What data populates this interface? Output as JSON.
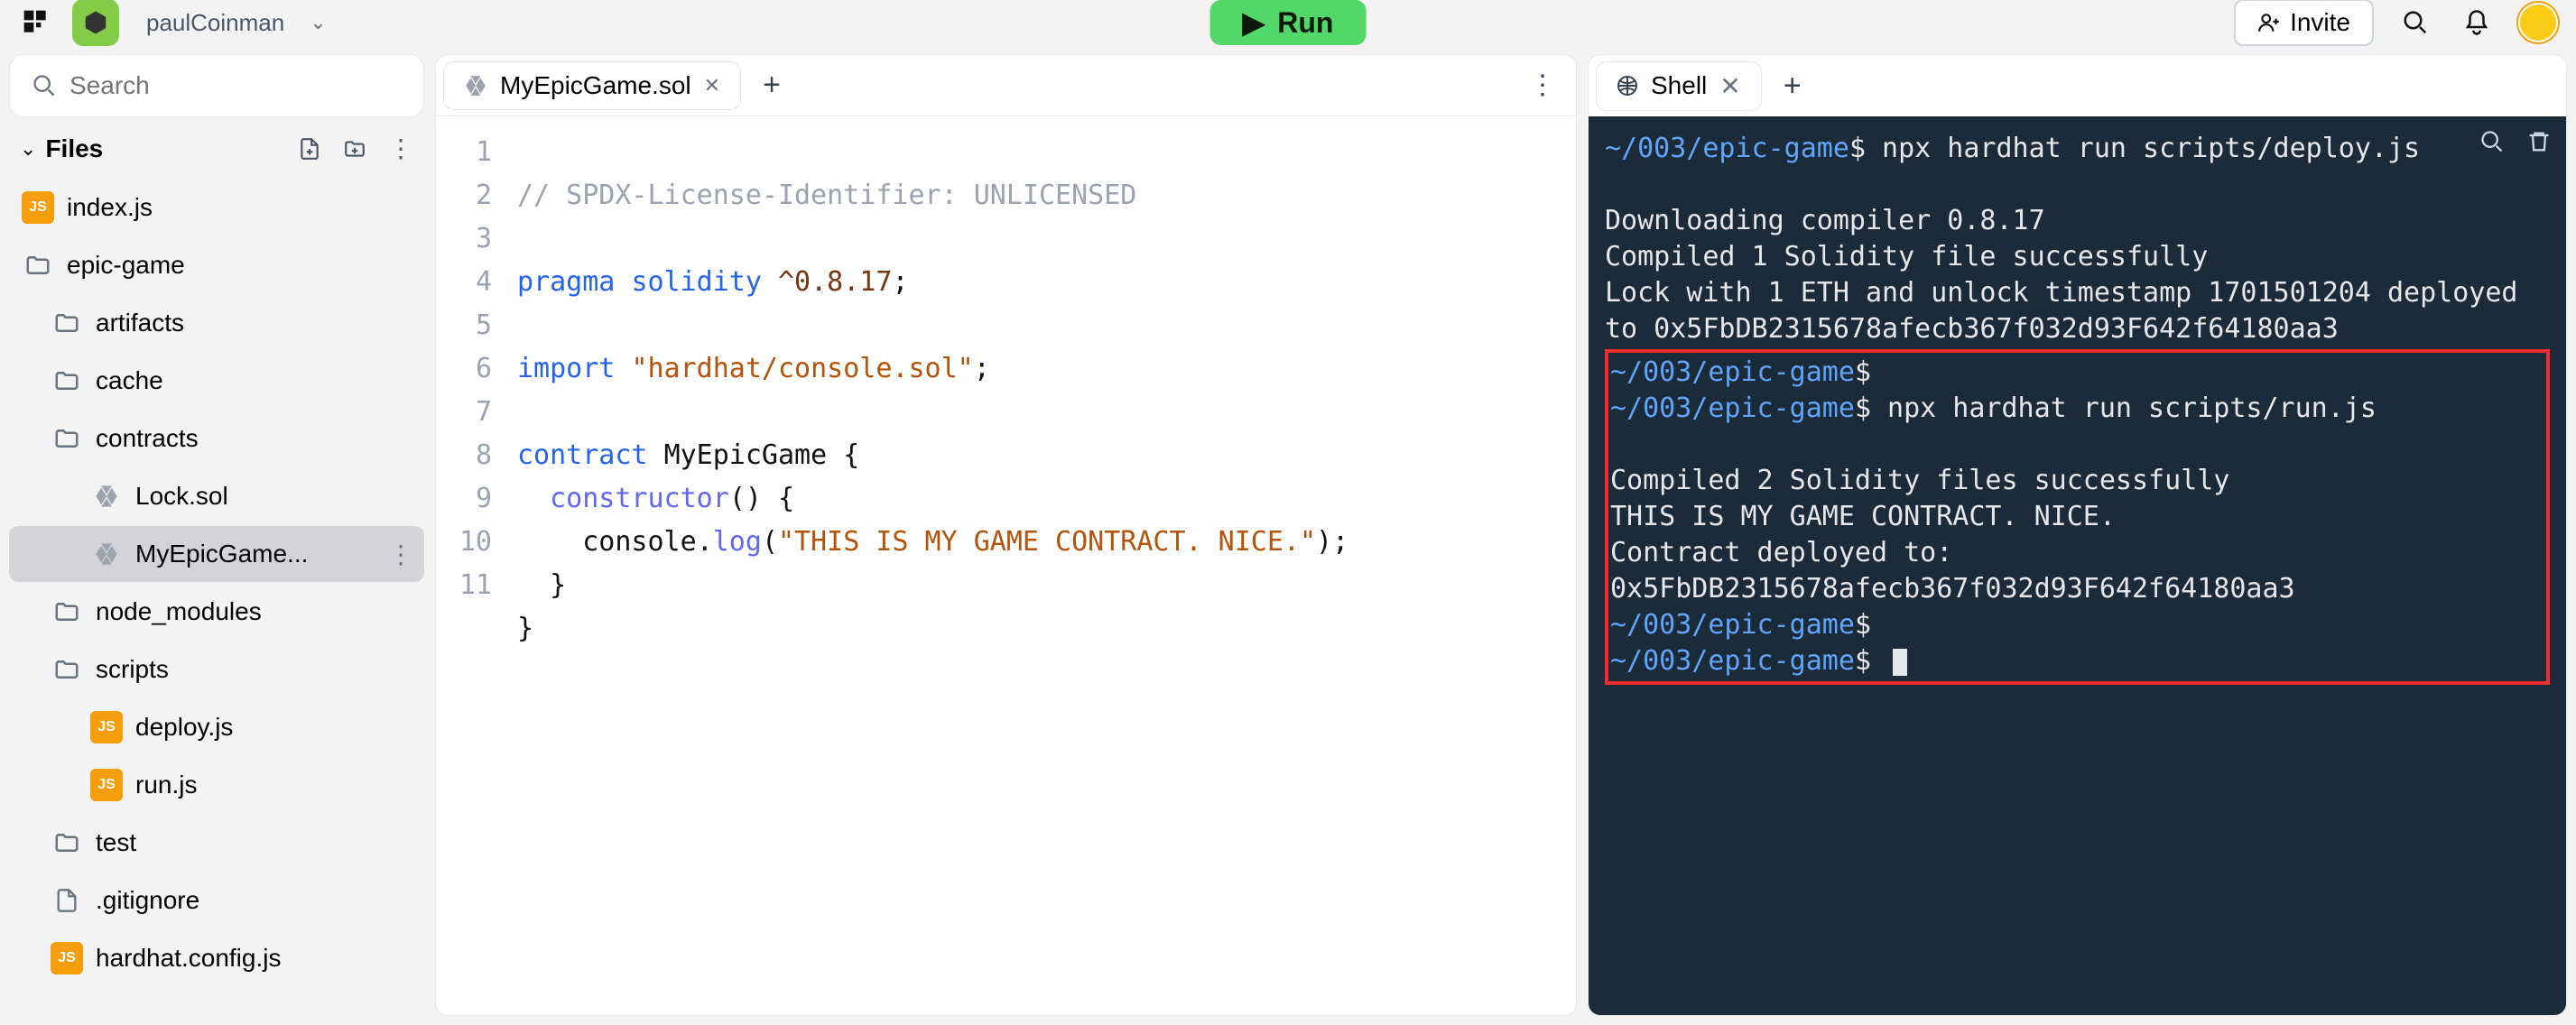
{
  "header": {
    "username": "paulCoinman",
    "run_label": "Run",
    "invite_label": "Invite"
  },
  "sidebar": {
    "search_placeholder": "Search",
    "files_label": "Files",
    "items": [
      {
        "label": "index.js",
        "icon": "js",
        "depth": 1
      },
      {
        "label": "epic-game",
        "icon": "fold",
        "depth": 1
      },
      {
        "label": "artifacts",
        "icon": "fold",
        "depth": 2
      },
      {
        "label": "cache",
        "icon": "fold",
        "depth": 2
      },
      {
        "label": "contracts",
        "icon": "fold",
        "depth": 2
      },
      {
        "label": "Lock.sol",
        "icon": "sol",
        "depth": 3
      },
      {
        "label": "MyEpicGame...",
        "icon": "sol",
        "depth": 3,
        "selected": true
      },
      {
        "label": "node_modules",
        "icon": "fold",
        "depth": 2
      },
      {
        "label": "scripts",
        "icon": "fold",
        "depth": 2
      },
      {
        "label": "deploy.js",
        "icon": "js",
        "depth": 3
      },
      {
        "label": "run.js",
        "icon": "js",
        "depth": 3
      },
      {
        "label": "test",
        "icon": "fold",
        "depth": 2
      },
      {
        "label": ".gitignore",
        "icon": "file",
        "depth": 2
      },
      {
        "label": "hardhat.config.js",
        "icon": "js",
        "depth": 2
      }
    ]
  },
  "editor": {
    "tab_label": "MyEpicGame.sol",
    "lines": {
      "l1": "// SPDX-License-Identifier: UNLICENSED",
      "l3_kw": "pragma",
      "l3_id": "solidity",
      "l3_ver": "^0.8.17",
      "l3_p": ";",
      "l5_kw": "import",
      "l5_str": "\"hardhat/console.sol\"",
      "l5_p": ";",
      "l7_kw": "contract",
      "l7_id": "MyEpicGame",
      "l7_b": "{",
      "l8_fn": "constructor",
      "l8_p": "() {",
      "l9_obj": "console",
      "l9_dot": ".",
      "l9_m": "log",
      "l9_op": "(",
      "l9_str": "\"THIS IS MY GAME CONTRACT. NICE.\"",
      "l9_cp": ");",
      "l10": "}",
      "l11": "}"
    }
  },
  "shell": {
    "tab_label": "Shell",
    "lines": {
      "p1": "~/003/epic-game",
      "cmd1": "$ npx hardhat run scripts/deploy.js",
      "o1": "Downloading compiler 0.8.17",
      "o2": "Compiled 1 Solidity file successfully",
      "o3": "Lock with 1 ETH and unlock timestamp 1701501204 deployed to 0x5FbDB2315678afecb367f032d93F642f64180aa3",
      "p2": "~/003/epic-game",
      "d2": "$",
      "p3": "~/003/epic-game",
      "cmd3": "$ npx hardhat run scripts/run.js",
      "o4": "Compiled 2 Solidity files successfully",
      "o5": "THIS IS MY GAME CONTRACT. NICE.",
      "o6": "Contract deployed to: 0x5FbDB2315678afecb367f032d93F642f64180aa3",
      "p4": "~/003/epic-game",
      "d4": "$",
      "p5": "~/003/epic-game",
      "d5": "$ "
    }
  }
}
